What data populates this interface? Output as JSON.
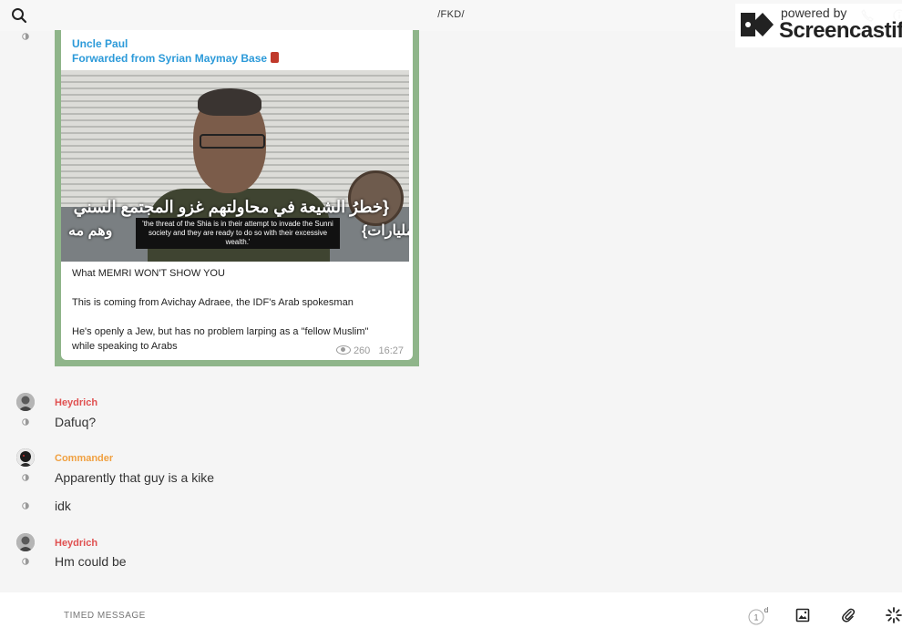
{
  "header": {
    "title": "/FKD/"
  },
  "watermark": {
    "powered": "powered by",
    "brand": "Screencastify"
  },
  "forward": {
    "author": "Uncle Paul",
    "from": "Forwarded from Syrian Maymay Base",
    "video": {
      "arabic_line1": "{خطرُ الشيعة في محاولتهم غزو المجتمع السني",
      "arabic_line2_left": "وهم مه",
      "arabic_line2_right": "المليارات}",
      "subtitle": "'the threat of the Shia is in their attempt to invade the Sunni society and they are ready to do so with their excessive wealth.'"
    },
    "text1": "What MEMRI WON'T SHOW YOU",
    "text2": "This is coming from Avichay Adraee, the IDF's Arab spokesman",
    "text3a": "He's openly a Jew, but has no problem larping as a \"fellow Muslim\"",
    "text3b": "while speaking to Arabs",
    "views": "260",
    "time": "16:27"
  },
  "messages": [
    {
      "sender": "Heydrich",
      "text": "Dafuq?",
      "color": "#e05050"
    },
    {
      "sender": "Commander",
      "text": "Apparently that guy is a kike",
      "color": "#f0a040"
    },
    {
      "text": "idk"
    },
    {
      "sender": "Heydrich",
      "text": "Hm could be",
      "color": "#e05050"
    }
  ],
  "composer": {
    "placeholder": "TIMED MESSAGE",
    "timer": "1",
    "timer_unit": "d"
  }
}
